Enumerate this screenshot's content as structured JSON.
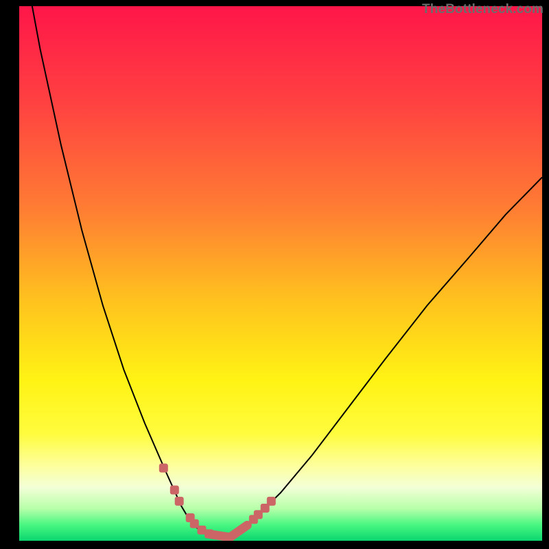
{
  "attribution": "TheBottleneck.com",
  "chart_data": {
    "type": "line",
    "title": "",
    "xlabel": "",
    "ylabel": "",
    "xlim": [
      0,
      100
    ],
    "ylim": [
      0,
      100
    ],
    "grid": false,
    "background": "vertical-gradient red→yellow→green",
    "series": [
      {
        "name": "bottleneck-curve",
        "x": [
          0,
          4,
          8,
          12,
          16,
          20,
          24,
          28,
          31,
          33,
          35,
          37,
          38.5,
          40,
          42,
          45,
          50,
          56,
          63,
          70,
          78,
          86,
          93,
          100
        ],
        "y": [
          113,
          92,
          74,
          58,
          44,
          32,
          22,
          13,
          6.5,
          3.2,
          1.6,
          0.7,
          0.6,
          0.8,
          1.9,
          4.2,
          9,
          16,
          25,
          34,
          44,
          53,
          61,
          68
        ],
        "color": "#000000",
        "stroke_width": 2
      },
      {
        "name": "curve-highlight-dots-left",
        "x": [
          27.6,
          29.7,
          30.6,
          32.7,
          33.5,
          34.9,
          36.3
        ],
        "y": [
          13.6,
          9.5,
          7.4,
          4.3,
          3.2,
          2.0,
          1.3
        ],
        "color": "#cc6666",
        "marker": "rounded-square",
        "stroke_width": 13
      },
      {
        "name": "curve-highlight-dots-right",
        "x": [
          44.8,
          45.7,
          47.0,
          48.2
        ],
        "y": [
          4.0,
          4.9,
          6.1,
          7.4
        ],
        "color": "#cc6666",
        "marker": "rounded-square",
        "stroke_width": 13
      },
      {
        "name": "curve-highlight-minline",
        "x": [
          36.3,
          40.3,
          43.6
        ],
        "y": [
          1.25,
          0.65,
          2.9
        ],
        "color": "#cc6666",
        "marker": "rounded-square",
        "stroke_width": 13
      }
    ]
  }
}
